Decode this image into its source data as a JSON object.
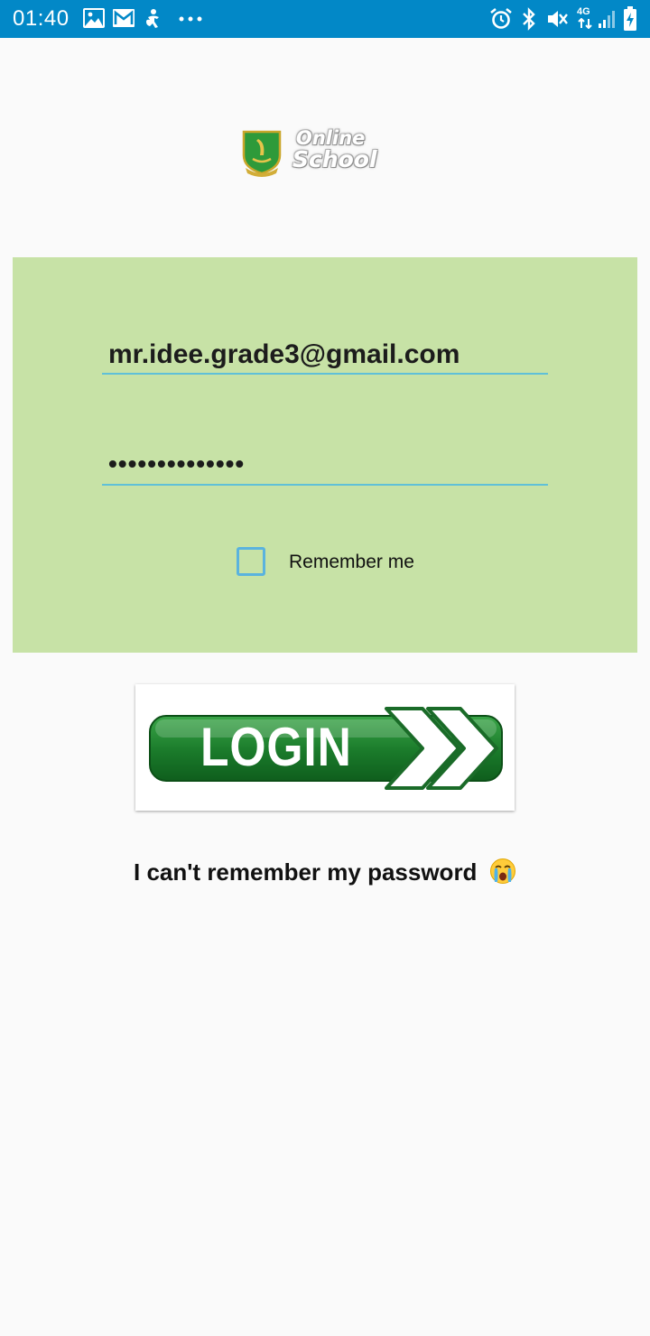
{
  "status_bar": {
    "time": "01:40",
    "network_label": "4G",
    "left_icons": [
      "image-icon",
      "gmail-icon",
      "accessibility-icon",
      "more-dots-icon"
    ],
    "right_icons": [
      "alarm-icon",
      "bluetooth-icon",
      "mute-icon",
      "network-4g-icon",
      "signal-icon",
      "battery-charging-icon"
    ],
    "color": "#0288c7"
  },
  "logo": {
    "line1": "Online",
    "line2": "School"
  },
  "login_form": {
    "email_value": "mr.idee.grade3@gmail.com",
    "password_value": "••••••••••••••",
    "remember_label": "Remember me",
    "remember_checked": false,
    "panel_color": "#c7e2a6",
    "underline_color": "#5fc0d8"
  },
  "login_button": {
    "label": "LOGIN",
    "color": "#1a7a2a"
  },
  "forgot_password": {
    "text": "I can't remember my password",
    "emoji": "crying-face-icon"
  }
}
